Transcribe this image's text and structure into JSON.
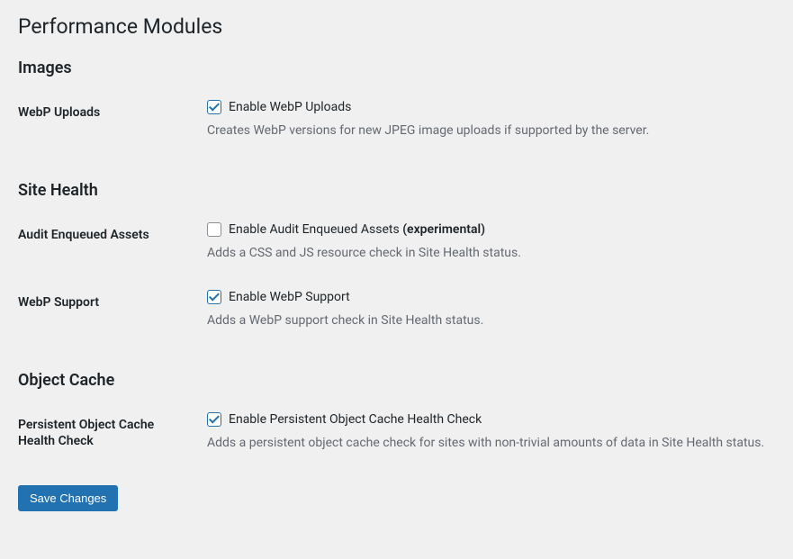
{
  "page": {
    "title": "Performance Modules"
  },
  "sections": {
    "images": {
      "heading": "Images",
      "webp_uploads": {
        "label": "WebP Uploads",
        "checkbox_label": "Enable WebP Uploads",
        "checked": true,
        "description": "Creates WebP versions for new JPEG image uploads if supported by the server."
      }
    },
    "site_health": {
      "heading": "Site Health",
      "audit_enqueued": {
        "label": "Audit Enqueued Assets",
        "checkbox_label": "Enable Audit Enqueued Assets ",
        "experimental": "(experimental)",
        "checked": false,
        "description": "Adds a CSS and JS resource check in Site Health status."
      },
      "webp_support": {
        "label": "WebP Support",
        "checkbox_label": "Enable WebP Support",
        "checked": true,
        "description": "Adds a WebP support check in Site Health status."
      }
    },
    "object_cache": {
      "heading": "Object Cache",
      "persistent_check": {
        "label": "Persistent Object Cache Health Check",
        "checkbox_label": "Enable Persistent Object Cache Health Check",
        "checked": true,
        "description": "Adds a persistent object cache check for sites with non-trivial amounts of data in Site Health status."
      }
    }
  },
  "submit": {
    "label": "Save Changes"
  }
}
